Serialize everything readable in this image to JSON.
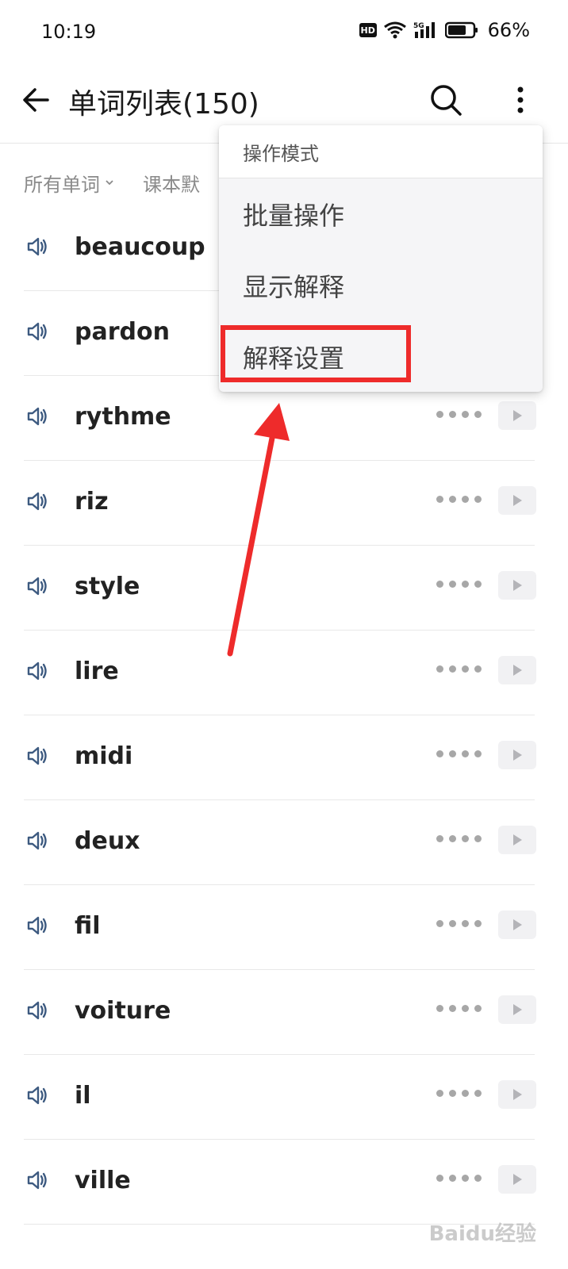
{
  "status_bar": {
    "time": "10:19",
    "hd": "HD",
    "network": "5G",
    "battery": "66%"
  },
  "app_bar": {
    "title": "单词列表(150)"
  },
  "filters": [
    {
      "label": "所有单词"
    },
    {
      "label": "课本默"
    }
  ],
  "words": [
    "beaucoup",
    "pardon",
    "rythme",
    "riz",
    "style",
    "lire",
    "midi",
    "deux",
    "fil",
    "voiture",
    "il",
    "ville"
  ],
  "menu": {
    "header": "操作模式",
    "items": [
      "批量操作",
      "显示解释",
      "解释设置"
    ],
    "highlighted_index": 2
  },
  "colors": {
    "annotation": "#ee2b2b",
    "speaker_icon": "#3d5a80"
  },
  "watermark": "Baidu经验"
}
